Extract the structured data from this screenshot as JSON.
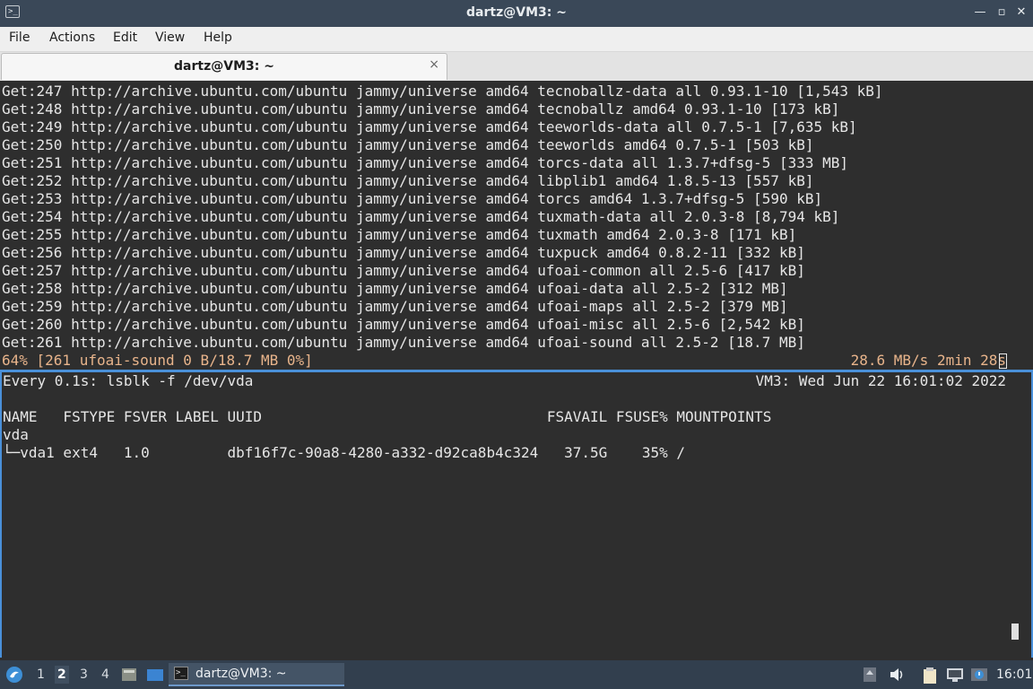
{
  "window": {
    "title": "dartz@VM3: ~",
    "controls": [
      "—",
      "▫",
      "✕"
    ]
  },
  "menu": [
    "File",
    "Actions",
    "Edit",
    "View",
    "Help"
  ],
  "tab": {
    "label": "dartz@VM3: ~",
    "close": "×"
  },
  "top_pane": {
    "lines": [
      "Get:247 http://archive.ubuntu.com/ubuntu jammy/universe amd64 tecnoballz-data all 0.93.1-10 [1,543 kB]",
      "Get:248 http://archive.ubuntu.com/ubuntu jammy/universe amd64 tecnoballz amd64 0.93.1-10 [173 kB]",
      "Get:249 http://archive.ubuntu.com/ubuntu jammy/universe amd64 teeworlds-data all 0.7.5-1 [7,635 kB]",
      "Get:250 http://archive.ubuntu.com/ubuntu jammy/universe amd64 teeworlds amd64 0.7.5-1 [503 kB]",
      "Get:251 http://archive.ubuntu.com/ubuntu jammy/universe amd64 torcs-data all 1.3.7+dfsg-5 [333 MB]",
      "Get:252 http://archive.ubuntu.com/ubuntu jammy/universe amd64 libplib1 amd64 1.8.5-13 [557 kB]",
      "Get:253 http://archive.ubuntu.com/ubuntu jammy/universe amd64 torcs amd64 1.3.7+dfsg-5 [590 kB]",
      "Get:254 http://archive.ubuntu.com/ubuntu jammy/universe amd64 tuxmath-data all 2.0.3-8 [8,794 kB]",
      "Get:255 http://archive.ubuntu.com/ubuntu jammy/universe amd64 tuxmath amd64 2.0.3-8 [171 kB]",
      "Get:256 http://archive.ubuntu.com/ubuntu jammy/universe amd64 tuxpuck amd64 0.8.2-11 [332 kB]",
      "Get:257 http://archive.ubuntu.com/ubuntu jammy/universe amd64 ufoai-common all 2.5-6 [417 kB]",
      "Get:258 http://archive.ubuntu.com/ubuntu jammy/universe amd64 ufoai-data all 2.5-2 [312 MB]",
      "Get:259 http://archive.ubuntu.com/ubuntu jammy/universe amd64 ufoai-maps all 2.5-2 [379 MB]",
      "Get:260 http://archive.ubuntu.com/ubuntu jammy/universe amd64 ufoai-misc all 2.5-6 [2,542 kB]",
      "Get:261 http://archive.ubuntu.com/ubuntu jammy/universe amd64 ufoai-sound all 2.5-2 [18.7 MB]"
    ],
    "status_left": "64% [261 ufoai-sound 0 B/18.7 MB 0%]",
    "status_right": "28.6 MB/s 2min 28s"
  },
  "bottom_pane": {
    "watch_header_left": "Every 0.1s: lsblk -f /dev/vda",
    "watch_header_right": "VM3: Wed Jun 22 16:01:02 2022",
    "table_header": "NAME   FSTYPE FSVER LABEL UUID                                 FSAVAIL FSUSE% MOUNTPOINTS",
    "rows": [
      "vda",
      "└─vda1 ext4   1.0         dbf16f7c-90a8-4280-a332-d92ca8b4c324   37.5G    35% /"
    ]
  },
  "taskbar": {
    "workspaces": [
      "1",
      "2",
      "3",
      "4"
    ],
    "active_workspace": "2",
    "task_label": "dartz@VM3: ~",
    "clock": "16:01"
  }
}
